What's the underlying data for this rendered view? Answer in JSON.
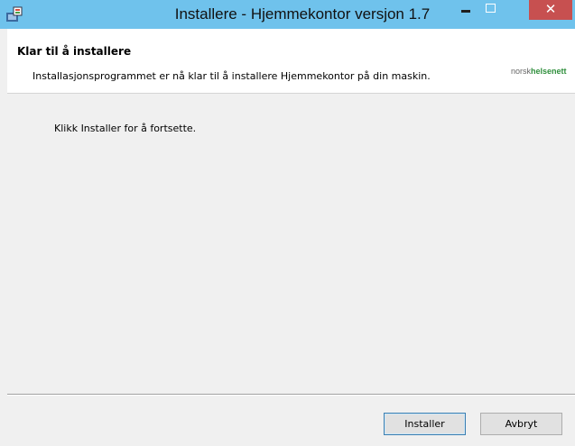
{
  "window": {
    "title": "Installere - Hjemmekontor versjon 1.7",
    "close_glyph": "✕",
    "icons": [
      "installer-app-icon",
      "minimize-icon",
      "maximize-icon",
      "close-icon"
    ]
  },
  "header": {
    "title": "Klar til å installere",
    "subtitle": "Installasjonsprogrammet er nå klar til å installere Hjemmekontor på din maskin.",
    "logo_prefix": "norsk",
    "logo_bold": "helsenett"
  },
  "main": {
    "text": "Klikk Installer for å fortsette."
  },
  "footer": {
    "install_label": "Installer",
    "cancel_label": "Avbryt"
  },
  "colors": {
    "titlebar": "#6fc2ec",
    "close_button": "#c75050",
    "logo_green": "#2f8f3c"
  }
}
